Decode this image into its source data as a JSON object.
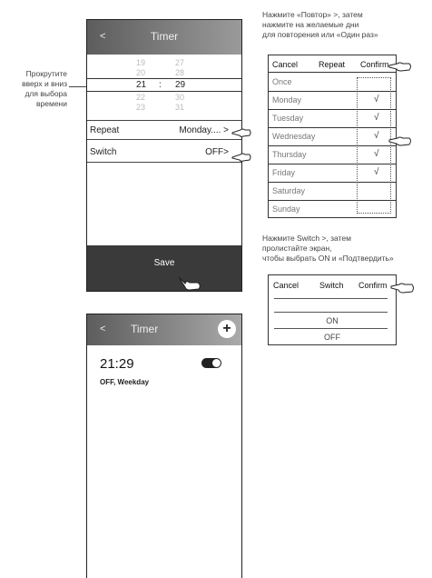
{
  "left_note": "Прокрутите\nвверх и вниз\nдля выбора\nвремени",
  "phone1": {
    "back": "<",
    "title": "Timer",
    "picker": {
      "rows": [
        {
          "hour": "19",
          "minute": "27"
        },
        {
          "hour": "20",
          "minute": "28"
        },
        {
          "hour": "21",
          "minute": "29",
          "separator": ":"
        },
        {
          "hour": "22",
          "minute": "30"
        },
        {
          "hour": "23",
          "minute": "31"
        }
      ]
    },
    "repeat_label": "Repeat",
    "repeat_value": "Monday....  >",
    "switch_label": "Switch",
    "switch_value": "OFF>",
    "save_label": "Save"
  },
  "phone2": {
    "back": "<",
    "title": "Timer",
    "add_icon": "+",
    "time": "21:29",
    "subtitle": "OFF, Weekday",
    "toggle_on": true
  },
  "repeat_note": "Нажмите «Повтор» >, затем\nнажмите на желаемые дни\nдля повторения или «Один раз»",
  "repeat_table": {
    "cancel": "Cancel",
    "title": "Repeat",
    "confirm": "Confirm",
    "days": [
      {
        "label": "Once",
        "checked": false
      },
      {
        "label": "Monday",
        "checked": true
      },
      {
        "label": "Tuesday",
        "checked": true
      },
      {
        "label": "Wednesday",
        "checked": true
      },
      {
        "label": "Thursday",
        "checked": true
      },
      {
        "label": "Friday",
        "checked": true
      },
      {
        "label": "Saturday",
        "checked": false
      },
      {
        "label": "Sunday",
        "checked": false
      }
    ],
    "check_mark": "√"
  },
  "switch_note": "Нажмите Switch >, затем\nпролистайте экран,\nчтобы выбрать ON и «Подтвердить»",
  "switch_table": {
    "cancel": "Cancel",
    "title": "Switch",
    "confirm": "Confirm",
    "options": [
      "ON",
      "OFF"
    ]
  }
}
